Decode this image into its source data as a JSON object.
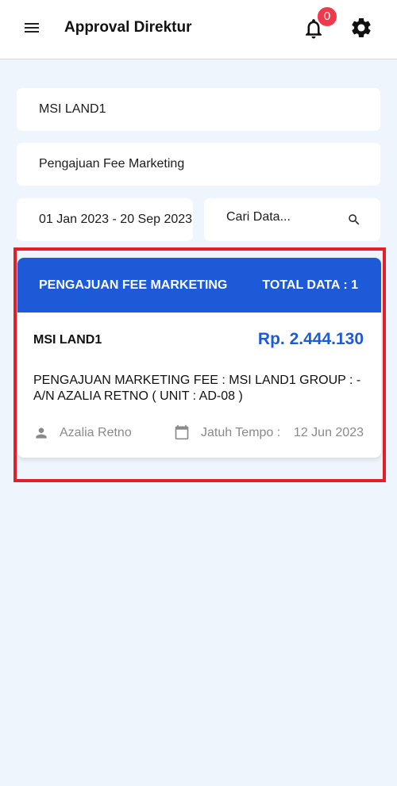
{
  "header": {
    "title": "Approval Direktur",
    "notification_count": "0"
  },
  "filters": {
    "company": "MSI LAND1",
    "submission_type": "Pengajuan Fee Marketing",
    "date_range": "01 Jan 2023 - 20 Sep 2023",
    "search_placeholder": "Cari Data..."
  },
  "result_card": {
    "title": "PENGAJUAN FEE MARKETING",
    "total_label": "TOTAL DATA : 1",
    "items": [
      {
        "company": "MSI LAND1",
        "amount": "Rp. 2.444.130",
        "description": "PENGAJUAN MARKETING FEE : MSI LAND1 GROUP : - A/N AZALIA RETNO ( UNIT : AD-08 )",
        "person": "Azalia Retno",
        "due_label": "Jatuh Tempo :",
        "due_date": "12 Jun 2023"
      }
    ]
  },
  "colors": {
    "primary": "#1d5ad8",
    "badge": "#ee3a4b",
    "background": "#eef5fd",
    "highlight": "#e3202a"
  },
  "icons": [
    "menu-icon",
    "bell-icon",
    "gear-icon",
    "search-icon",
    "person-icon",
    "calendar-icon"
  ]
}
